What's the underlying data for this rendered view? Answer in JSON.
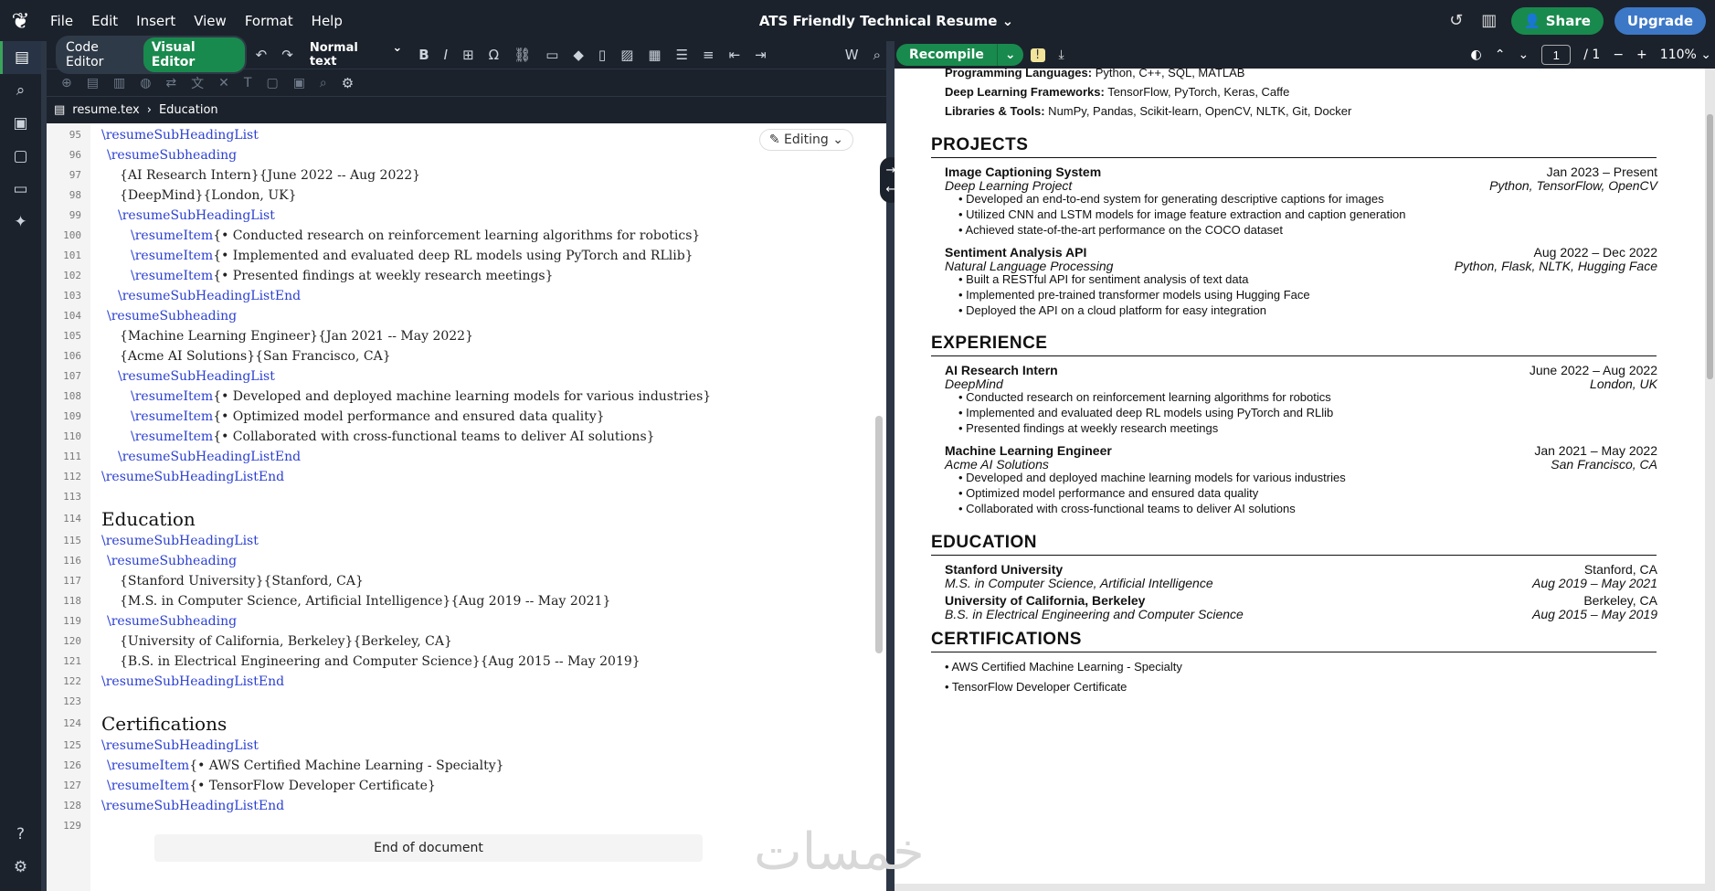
{
  "menu": [
    "File",
    "Edit",
    "Insert",
    "View",
    "Format",
    "Help"
  ],
  "doc_title": "ATS Friendly Technical Resume",
  "top": {
    "share": "Share",
    "upgrade": "Upgrade"
  },
  "editor": {
    "code_label": "Code Editor",
    "visual_label": "Visual Editor",
    "style_select": "Normal text",
    "breadcrumb_file": "resume.tex",
    "breadcrumb_section": "Education",
    "editing": "Editing",
    "end_of_document": "End of document"
  },
  "code_lines": [
    {
      "n": "95",
      "t": "\\resumeSubHeadingList",
      "i": 60,
      "k": "cmd"
    },
    {
      "n": "96",
      "t": "\\resumeSubheading",
      "i": 66,
      "k": "cmd"
    },
    {
      "n": "97",
      "t": "{AI Research Intern}{June 2022 -- Aug 2022}",
      "i": 80,
      "k": "txt"
    },
    {
      "n": "98",
      "t": "{DeepMind}{London, UK}",
      "i": 80,
      "k": "txt"
    },
    {
      "n": "99",
      "t": "\\resumeSubHeadingList",
      "i": 78,
      "k": "cmd"
    },
    {
      "n": "100",
      "t": "\\resumeItem{• Conducted research on reinforcement learning algorithms for robotics}",
      "i": 92,
      "k": "item"
    },
    {
      "n": "101",
      "t": "\\resumeItem{• Implemented and evaluated deep RL models using PyTorch and RLlib}",
      "i": 92,
      "k": "item"
    },
    {
      "n": "102",
      "t": "\\resumeItem{• Presented findings at weekly research meetings}",
      "i": 92,
      "k": "item"
    },
    {
      "n": "103",
      "t": "\\resumeSubHeadingListEnd",
      "i": 78,
      "k": "cmd"
    },
    {
      "n": "104",
      "t": "\\resumeSubheading",
      "i": 66,
      "k": "cmd"
    },
    {
      "n": "105",
      "t": "{Machine Learning Engineer}{Jan 2021 -- May 2022}",
      "i": 80,
      "k": "txt"
    },
    {
      "n": "106",
      "t": "{Acme AI Solutions}{San Francisco, CA}",
      "i": 80,
      "k": "txt"
    },
    {
      "n": "107",
      "t": "\\resumeSubHeadingList",
      "i": 78,
      "k": "cmd"
    },
    {
      "n": "108",
      "t": "\\resumeItem{• Developed and deployed machine learning models for various industries}",
      "i": 92,
      "k": "item"
    },
    {
      "n": "109",
      "t": "\\resumeItem{• Optimized model performance and ensured data quality}",
      "i": 92,
      "k": "item"
    },
    {
      "n": "110",
      "t": "\\resumeItem{• Collaborated with cross-functional teams to deliver AI solutions}",
      "i": 92,
      "k": "item"
    },
    {
      "n": "111",
      "t": "\\resumeSubHeadingListEnd",
      "i": 78,
      "k": "cmd"
    },
    {
      "n": "112",
      "t": "\\resumeSubHeadingListEnd",
      "i": 60,
      "k": "cmd"
    },
    {
      "n": "113",
      "t": "",
      "i": 60,
      "k": "txt"
    },
    {
      "n": "114",
      "t": "Education",
      "i": 60,
      "k": "sec"
    },
    {
      "n": "115",
      "t": "\\resumeSubHeadingList",
      "i": 60,
      "k": "cmd"
    },
    {
      "n": "116",
      "t": "\\resumeSubheading",
      "i": 66,
      "k": "cmd"
    },
    {
      "n": "117",
      "t": "{Stanford University}{Stanford, CA}",
      "i": 80,
      "k": "txt"
    },
    {
      "n": "118",
      "t": "{M.S. in Computer Science, Artificial Intelligence}{Aug 2019 -- May 2021}",
      "i": 80,
      "k": "txt"
    },
    {
      "n": "119",
      "t": "\\resumeSubheading",
      "i": 66,
      "k": "cmd"
    },
    {
      "n": "120",
      "t": "{University of California, Berkeley}{Berkeley, CA}",
      "i": 80,
      "k": "txt"
    },
    {
      "n": "121",
      "t": "{B.S. in Electrical Engineering and Computer Science}{Aug 2015 -- May 2019}",
      "i": 80,
      "k": "txt"
    },
    {
      "n": "122",
      "t": "\\resumeSubHeadingListEnd",
      "i": 60,
      "k": "cmd"
    },
    {
      "n": "123",
      "t": "",
      "i": 60,
      "k": "txt"
    },
    {
      "n": "124",
      "t": "Certifications",
      "i": 60,
      "k": "sec"
    },
    {
      "n": "125",
      "t": "\\resumeSubHeadingList",
      "i": 60,
      "k": "cmd"
    },
    {
      "n": "126",
      "t": "\\resumeItem{• AWS Certified Machine Learning - Specialty}",
      "i": 66,
      "k": "item"
    },
    {
      "n": "127",
      "t": "\\resumeItem{• TensorFlow Developer Certificate}",
      "i": 66,
      "k": "item"
    },
    {
      "n": "128",
      "t": "\\resumeSubHeadingListEnd",
      "i": 60,
      "k": "cmd"
    },
    {
      "n": "129",
      "t": "",
      "i": 60,
      "k": "txt"
    }
  ],
  "pdf": {
    "recompile": "Recompile",
    "page_current": "1",
    "page_total": "/ 1",
    "zoom": "110%",
    "skills": [
      {
        "label": "Programming Languages:",
        "value": " Python, C++, SQL, MATLAB"
      },
      {
        "label": "Deep Learning Frameworks:",
        "value": " TensorFlow, PyTorch, Keras, Caffe"
      },
      {
        "label": "Libraries & Tools:",
        "value": " NumPy, Pandas, Scikit-learn, OpenCV, NLTK, Git, Docker"
      }
    ],
    "projects_heading": "PROJECTS",
    "experience_heading": "EXPERIENCE",
    "education_heading": "EDUCATION",
    "certifications_heading": "CERTIFICATIONS",
    "projects": [
      {
        "title": "Image Captioning System",
        "date": "Jan 2023 – Present",
        "sub": "Deep Learning Project",
        "tech": "Python, TensorFlow, OpenCV",
        "bullets": [
          "Developed an end-to-end system for generating descriptive captions for images",
          "Utilized CNN and LSTM models for image feature extraction and caption generation",
          "Achieved state-of-the-art performance on the COCO dataset"
        ]
      },
      {
        "title": "Sentiment Analysis API",
        "date": "Aug 2022 – Dec 2022",
        "sub": "Natural Language Processing",
        "tech": "Python, Flask, NLTK, Hugging Face",
        "bullets": [
          "Built a RESTful API for sentiment analysis of text data",
          "Implemented pre-trained transformer models using Hugging Face",
          "Deployed the API on a cloud platform for easy integration"
        ]
      }
    ],
    "experience": [
      {
        "title": "AI Research Intern",
        "date": "June 2022 – Aug 2022",
        "sub": "DeepMind",
        "loc": "London, UK",
        "bullets": [
          "Conducted research on reinforcement learning algorithms for robotics",
          "Implemented and evaluated deep RL models using PyTorch and RLlib",
          "Presented findings at weekly research meetings"
        ]
      },
      {
        "title": "Machine Learning Engineer",
        "date": "Jan 2021 – May 2022",
        "sub": "Acme AI Solutions",
        "loc": "San Francisco, CA",
        "bullets": [
          "Developed and deployed machine learning models for various industries",
          "Optimized model performance and ensured data quality",
          "Collaborated with cross-functional teams to deliver AI solutions"
        ]
      }
    ],
    "education": [
      {
        "school": "Stanford University",
        "loc": "Stanford, CA",
        "degree": "M.S. in Computer Science, Artificial Intelligence",
        "date": "Aug 2019 – May 2021"
      },
      {
        "school": "University of California, Berkeley",
        "loc": "Berkeley, CA",
        "degree": "B.S. in Electrical Engineering and Computer Science",
        "date": "Aug 2015 – May 2019"
      }
    ],
    "certifications": [
      "• AWS Certified Machine Learning - Specialty",
      "• TensorFlow Developer Certificate"
    ]
  },
  "watermark": "خمسات"
}
